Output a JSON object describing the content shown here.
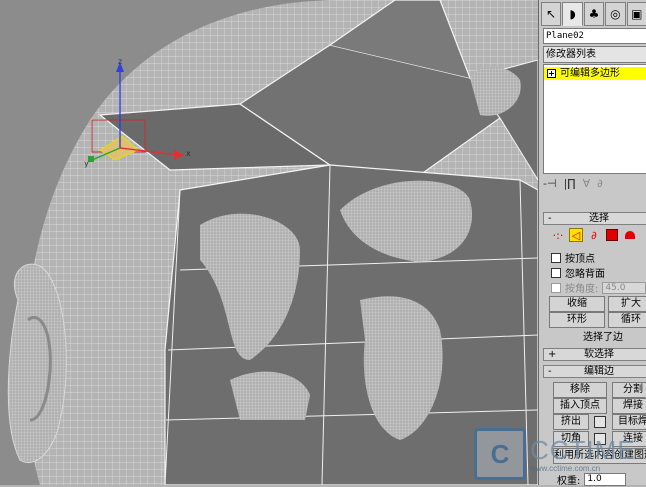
{
  "command_panel": {
    "tabs": [
      {
        "icon": "create-tab-icon",
        "glyph": "↖"
      },
      {
        "icon": "modify-tab-icon",
        "glyph": "◗"
      },
      {
        "icon": "hierarchy-tab-icon",
        "glyph": "♣"
      },
      {
        "icon": "motion-tab-icon",
        "glyph": "◎"
      },
      {
        "icon": "display-tab-icon",
        "glyph": "▣"
      }
    ],
    "object_name": "Plane02",
    "modifier_list": "修改器列表",
    "stack": {
      "items": [
        {
          "label": "可编辑多边形",
          "highlight": "#ffff00"
        }
      ]
    },
    "stack_tools": {
      "pin": "-⊣",
      "show_end": "|∏",
      "unique": "∀",
      "remove": "∂"
    }
  },
  "selection_rollout": {
    "sign": "-",
    "title": "选择",
    "vertex_glyph": "·:·",
    "edge_glyph": "◁",
    "border_glyph": "∂",
    "poly_color": "#e00000",
    "element_color": "#e00000",
    "by_vertex": "按顶点",
    "ignore_backfacing": "忽略背面",
    "by_angle": "按角度:",
    "angle_value": "45.0",
    "shrink": "收缩",
    "grow": "扩大",
    "ring": "环形",
    "loop": "循环",
    "status": "选择了边"
  },
  "soft_selection_rollout": {
    "sign": "+",
    "title": "软选择"
  },
  "edit_edges_rollout": {
    "sign": "-",
    "title": "编辑边",
    "remove": "移除",
    "split": "分割",
    "insert_vertex": "插入顶点",
    "weld": "焊接",
    "extrude": "挤出",
    "target_weld": "目标焊",
    "chamfer": "切角",
    "connect": "连接",
    "create_shape": "利用所选内容创建图形",
    "weight_label": "权重:",
    "weight_value": "1.0"
  },
  "viewport": {
    "gizmo": {
      "x": "x",
      "y": "y",
      "z": "z"
    }
  },
  "watermark": {
    "logo": "C",
    "brand": "CCTIME",
    "url": "www.cctime.com.cn"
  }
}
